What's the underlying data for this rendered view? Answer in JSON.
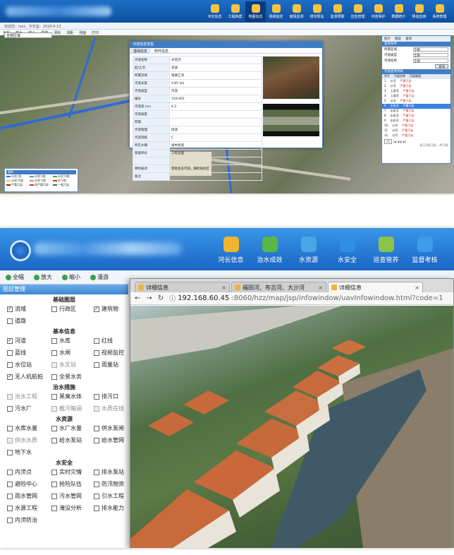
{
  "top_panel": {
    "header_nav": [
      "河长信息",
      "工程档案",
      "地图信息",
      "视频监控",
      "雨情监测",
      "排涝泵站",
      "监测预警",
      "应急管理",
      "河道保护",
      "数据统计",
      "移动应用",
      "系统管理"
    ],
    "status_line": "欢迎您：test，今天是：2018-9-13",
    "toolbar": [
      "全幅",
      "放大",
      "缩小",
      "漫游",
      "清除",
      "测距",
      "测面",
      "打印"
    ],
    "region_select": "全部区域",
    "dialog": {
      "title": "河道信息查看",
      "tabs": [
        "基础信息",
        "附件信息"
      ],
      "rows": [
        {
          "k": "河道名称",
          "v": "水花河"
        },
        {
          "k": "起/止点",
          "v": "浩溪"
        },
        {
          "k": "所属流域",
          "v": "钱塘江湾"
        },
        {
          "k": "河道长度",
          "v": "0.85 km"
        },
        {
          "k": "河道类型",
          "v": "河道"
        },
        {
          "k": "编号",
          "v": "310-001"
        },
        {
          "k": "河道宽 (m)",
          "v": "6.3"
        },
        {
          "k": "河道坡度",
          "v": ""
        },
        {
          "k": "所属",
          "v": ""
        },
        {
          "k": "河道管理",
          "v": "街道"
        },
        {
          "k": "河道等级",
          "v": "C"
        },
        {
          "k": "所在乡镇",
          "v": "城中街道"
        },
        {
          "k": "管理单位",
          "v": "工程治理"
        },
        {
          "k": "",
          "v": ""
        },
        {
          "k": "特色描述",
          "v": "景观生态河道，横跨居民区"
        },
        {
          "k": "备注",
          "v": ""
        }
      ]
    },
    "right_panel": {
      "tabs": [
        "统计",
        "图层",
        "查询"
      ],
      "section1": "查询条件",
      "fields": [
        {
          "label": "所属区域",
          "value": "全部"
        },
        {
          "label": "河道类型",
          "value": "全部"
        },
        {
          "label": "河道名称",
          "value": "全部"
        }
      ],
      "search_button": "查询",
      "section2": "河道查询列表",
      "list_headers": [
        "序号",
        "河道名称",
        "河道管理"
      ],
      "list": [
        [
          "1",
          "沙河",
          "严重污染"
        ],
        [
          "2",
          "沙河",
          "严重污染"
        ],
        [
          "3",
          "上游河",
          "严重污染"
        ],
        [
          "4",
          "上游河",
          "严重污染"
        ],
        [
          "5",
          "沙河",
          "严重污染"
        ],
        [
          "6",
          "水花河",
          "严重污染"
        ],
        [
          "7",
          "水花河",
          "严重污染"
        ],
        [
          "8",
          "水花河",
          "严重污染"
        ],
        [
          "9",
          "水花河",
          "严重污染"
        ],
        [
          "10",
          "沙河",
          "严重污染"
        ],
        [
          "11",
          "沙河",
          "严重污染"
        ],
        [
          "12",
          "沙河",
          "严重污染"
        ]
      ],
      "pager": "20",
      "footer": "显示1到12条，共12条"
    },
    "legend": {
      "title": "图例",
      "items": [
        "水质 I类",
        "水质 II类",
        "水质 III类",
        "水质 IV类",
        "水质 V类",
        "劣 V类",
        "严重污染",
        "较严重污染",
        "一般污染"
      ]
    }
  },
  "bottom_panel": {
    "header_nav": [
      "河长信息",
      "治水成效",
      "水资源",
      "水安全",
      "巡查管养",
      "监督考核",
      "水"
    ],
    "toolbar": [
      "全幅",
      "放大",
      "缩小",
      "漫游"
    ],
    "layer_panel_title": "图层管理",
    "sections": [
      {
        "title": "基础图层",
        "items": [
          {
            "label": "流域",
            "checked": true,
            "enabled": true
          },
          {
            "label": "行政区",
            "checked": false,
            "enabled": true
          },
          {
            "label": "建筑物",
            "checked": true,
            "enabled": true
          },
          {
            "label": "道路",
            "checked": false,
            "enabled": true
          }
        ]
      },
      {
        "title": "基本信息",
        "items": [
          {
            "label": "河道",
            "checked": true,
            "enabled": true
          },
          {
            "label": "水库",
            "checked": false,
            "enabled": true
          },
          {
            "label": "红线",
            "checked": false,
            "enabled": true
          },
          {
            "label": "蓝线",
            "checked": false,
            "enabled": true
          },
          {
            "label": "水闸",
            "checked": false,
            "enabled": true
          },
          {
            "label": "视频监控",
            "checked": false,
            "enabled": true
          },
          {
            "label": "水位站",
            "checked": false,
            "enabled": true
          },
          {
            "label": "水文站",
            "checked": false,
            "enabled": false
          },
          {
            "label": "雨量站",
            "checked": false,
            "enabled": true
          },
          {
            "label": "无人机航拍",
            "checked": true,
            "enabled": true
          },
          {
            "label": "全景水务",
            "checked": false,
            "enabled": true
          }
        ]
      },
      {
        "title": "治水措施",
        "items": [
          {
            "label": "治水工程",
            "checked": false,
            "enabled": false
          },
          {
            "label": "黑臭水体",
            "checked": false,
            "enabled": true
          },
          {
            "label": "排污口",
            "checked": false,
            "enabled": true
          },
          {
            "label": "污水厂",
            "checked": false,
            "enabled": true
          },
          {
            "label": "截污箱涵",
            "checked": false,
            "enabled": false
          },
          {
            "label": "水质在线",
            "checked": false,
            "enabled": false
          }
        ]
      },
      {
        "title": "水资源",
        "items": [
          {
            "label": "水库水量",
            "checked": false,
            "enabled": true
          },
          {
            "label": "水厂水量",
            "checked": false,
            "enabled": true
          },
          {
            "label": "供水泵闸",
            "checked": false,
            "enabled": true
          },
          {
            "label": "供水水质",
            "checked": false,
            "enabled": false
          },
          {
            "label": "给水泵站",
            "checked": false,
            "enabled": true
          },
          {
            "label": "给水管网",
            "checked": false,
            "enabled": true
          },
          {
            "label": "地下水",
            "checked": false,
            "enabled": true
          }
        ]
      },
      {
        "title": "水安全",
        "items": [
          {
            "label": "内涝点",
            "checked": false,
            "enabled": true
          },
          {
            "label": "实时灾情",
            "checked": false,
            "enabled": true
          },
          {
            "label": "排水泵站",
            "checked": false,
            "enabled": true
          },
          {
            "label": "避险中心",
            "checked": false,
            "enabled": true
          },
          {
            "label": "抢险队伍",
            "checked": false,
            "enabled": true
          },
          {
            "label": "防汛物资",
            "checked": false,
            "enabled": true
          },
          {
            "label": "雨水管网",
            "checked": false,
            "enabled": true
          },
          {
            "label": "污水管网",
            "checked": false,
            "enabled": true
          },
          {
            "label": "引水工程",
            "checked": false,
            "enabled": true
          },
          {
            "label": "水源工程",
            "checked": false,
            "enabled": true
          },
          {
            "label": "淹没分析",
            "checked": false,
            "enabled": true
          },
          {
            "label": "排水能力",
            "checked": false,
            "enabled": true
          },
          {
            "label": "内涝防治",
            "checked": false,
            "enabled": true
          }
        ]
      }
    ],
    "browser": {
      "tabs": [
        {
          "title": "详细信息",
          "close": "×",
          "active": false
        },
        {
          "title": "福田河、布吉河、大沙河",
          "close": "×",
          "active": false
        },
        {
          "title": "详细信息",
          "close": "×",
          "active": true
        }
      ],
      "url_host": "192.168.60.45",
      "url_path": ":8060/hzz/map/jsp/infowindow/uavInfowindow.html?code=1"
    }
  }
}
